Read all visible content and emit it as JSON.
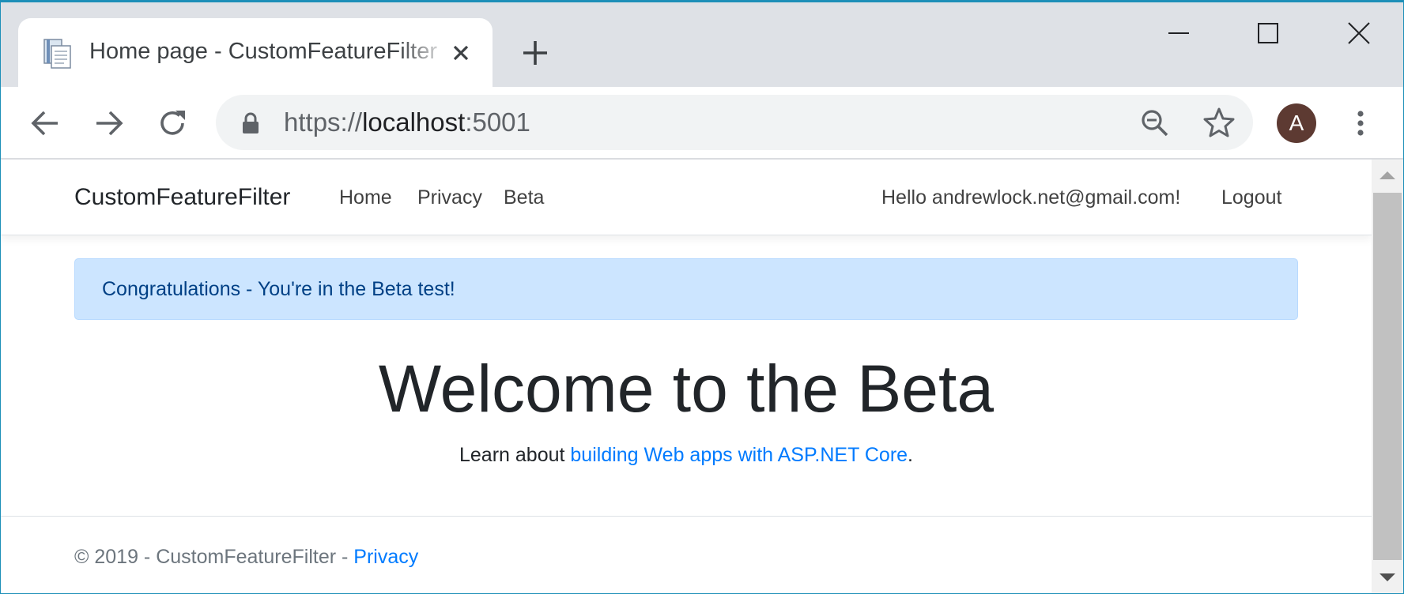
{
  "browser": {
    "tab": {
      "title": "Home page - CustomFeatureFilter",
      "favicon": "document-icon",
      "close_icon": "close-icon"
    },
    "new_tab_icon": "plus-icon",
    "window_controls": [
      "minimize-icon",
      "maximize-icon",
      "close-icon"
    ],
    "toolbar": {
      "back_icon": "arrow-left-icon",
      "forward_icon": "arrow-right-icon",
      "reload_icon": "reload-icon",
      "url": {
        "scheme": "https://",
        "host": "localhost",
        "port": ":5001"
      },
      "lock_icon": "lock-icon",
      "zoom_icon": "zoom-out-icon",
      "bookmark_icon": "star-icon",
      "profile_initial": "A",
      "profile_color": "#5d3a32",
      "menu_icon": "kebab-menu-icon"
    },
    "accent_color": "#1d8fb8"
  },
  "page": {
    "navbar": {
      "brand": "CustomFeatureFilter",
      "links": [
        "Home",
        "Privacy",
        "Beta"
      ],
      "greeting": "Hello andrewlock.net@gmail.com!",
      "logout": "Logout"
    },
    "alert": {
      "text": "Congratulations - You're in the Beta test!",
      "background": "#cce5ff",
      "text_color": "#004085"
    },
    "hero": {
      "title": "Welcome to the Beta",
      "subtitle_prefix": "Learn about ",
      "subtitle_link": "building Web apps with ASP.NET Core",
      "subtitle_suffix": "."
    },
    "footer": {
      "text": "© 2019 - CustomFeatureFilter - ",
      "link": "Privacy"
    },
    "link_color": "#007bff"
  }
}
